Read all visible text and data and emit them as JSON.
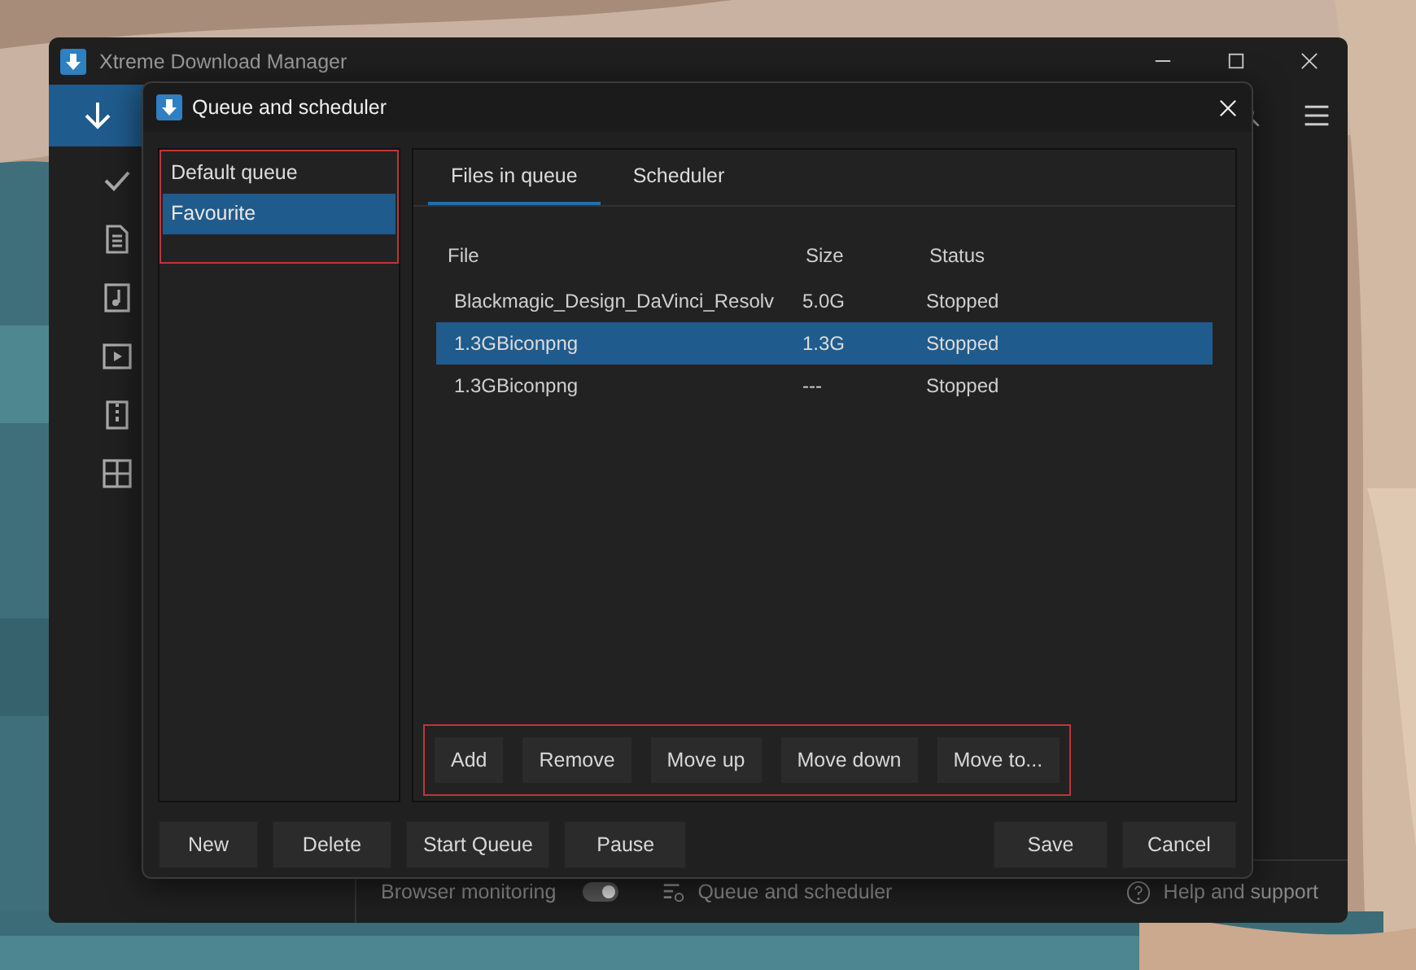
{
  "main_window": {
    "title": "Xtreme Download Manager",
    "nav_items": [
      {
        "kind": "download",
        "selected": true
      },
      {
        "kind": "check",
        "selected": false
      },
      {
        "kind": "document",
        "selected": false
      },
      {
        "kind": "music",
        "selected": false
      },
      {
        "kind": "video",
        "selected": false
      },
      {
        "kind": "archive",
        "selected": false
      },
      {
        "kind": "apps",
        "selected": false
      }
    ],
    "status_bar": {
      "browser_monitoring": {
        "label": "Browser monitoring",
        "on": true
      },
      "queue_link": "Queue and scheduler",
      "help_link": "Help and support"
    }
  },
  "dialog": {
    "title": "Queue and scheduler",
    "queues": [
      {
        "name": "Default queue",
        "selected": false
      },
      {
        "name": "Favourite",
        "selected": true
      }
    ],
    "tabs": [
      {
        "label": "Files in queue",
        "selected": true
      },
      {
        "label": "Scheduler",
        "selected": false
      }
    ],
    "table": {
      "columns": [
        "File",
        "Size",
        "Status"
      ],
      "rows": [
        {
          "file": "Blackmagic_Design_DaVinci_Resolv",
          "size": "5.0G",
          "status": "Stopped",
          "selected": false
        },
        {
          "file": "1.3GBiconpng",
          "size": "1.3G",
          "status": "Stopped",
          "selected": true
        },
        {
          "file": "1.3GBiconpng",
          "size": "---",
          "status": "Stopped",
          "selected": false
        }
      ]
    },
    "file_buttons": [
      "Add",
      "Remove",
      "Move up",
      "Move down",
      "Move to..."
    ],
    "queue_buttons": [
      "New",
      "Delete",
      "Start Queue",
      "Pause"
    ],
    "dialog_buttons": [
      "Save",
      "Cancel"
    ]
  }
}
